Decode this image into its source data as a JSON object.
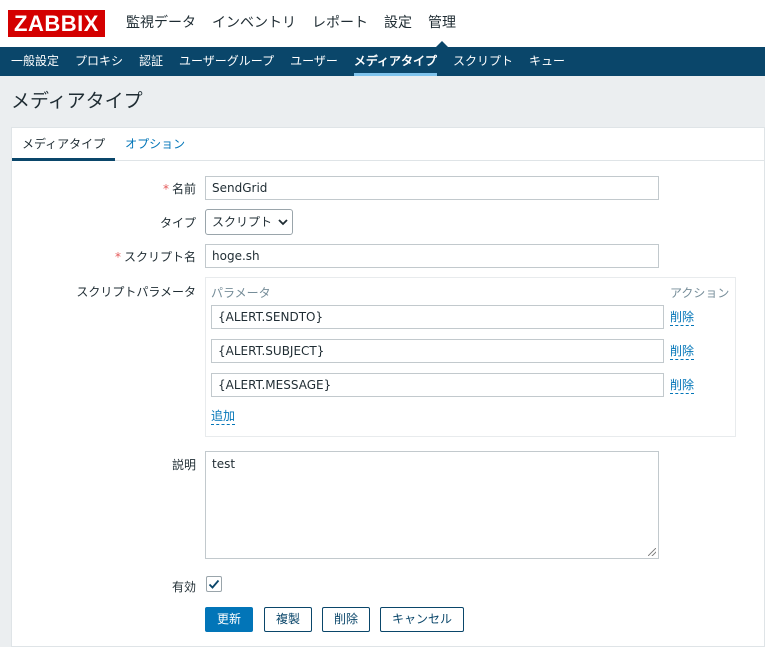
{
  "header": {
    "logo": "ZABBIX",
    "menu": [
      "監視データ",
      "インベントリ",
      "レポート",
      "設定",
      "管理"
    ]
  },
  "subnav": [
    "一般設定",
    "プロキシ",
    "認証",
    "ユーザーグループ",
    "ユーザー",
    "メディアタイプ",
    "スクリプト",
    "キュー"
  ],
  "page_title": "メディアタイプ",
  "tabs": [
    "メディアタイプ",
    "オプション"
  ],
  "form": {
    "required_mark": "*",
    "name_label": "名前",
    "name_value": "SendGrid",
    "type_label": "タイプ",
    "type_value": "スクリプト",
    "script_label": "スクリプト名",
    "script_value": "hoge.sh",
    "params_label": "スクリプトパラメータ",
    "params_header": "パラメータ",
    "action_header": "アクション",
    "params": [
      {
        "value": "{ALERT.SENDTO}",
        "remove": "削除"
      },
      {
        "value": "{ALERT.SUBJECT}",
        "remove": "削除"
      },
      {
        "value": "{ALERT.MESSAGE}",
        "remove": "削除"
      }
    ],
    "add_link": "追加",
    "desc_label": "説明",
    "desc_value": "test",
    "enabled_label": "有効",
    "enabled_checked": true
  },
  "buttons": {
    "update": "更新",
    "clone": "複製",
    "delete": "削除",
    "cancel": "キャンセル"
  },
  "colors": {
    "brand_red": "#d40000",
    "nav_dark": "#0a466a",
    "link_blue": "#0275b8",
    "required": "#e45959"
  },
  "icons": {
    "dropdown": "chevron-down-icon",
    "check": "check-icon",
    "resize": "resize-grip-icon"
  }
}
